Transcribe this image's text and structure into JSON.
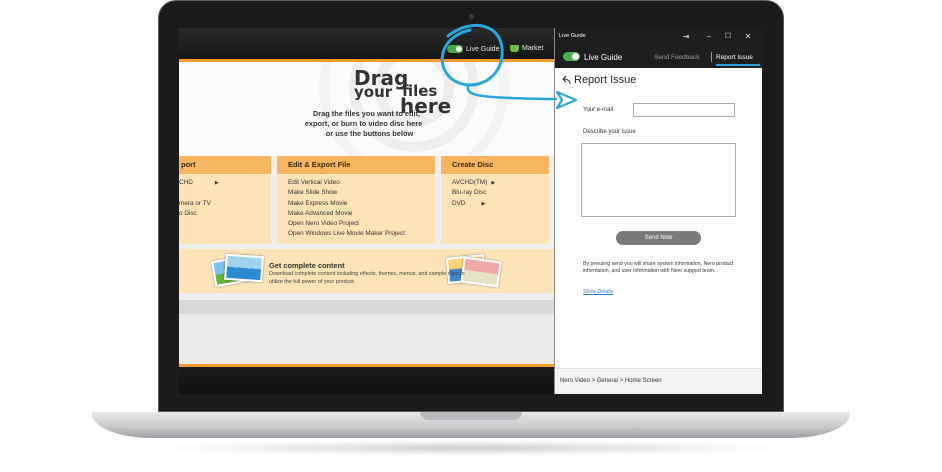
{
  "app": {
    "toolbar": {
      "live_guide": "Live Guide",
      "market": "Market"
    },
    "drop_area": {
      "drag_words": [
        "Drag",
        "your",
        "files",
        "here"
      ],
      "instructions": [
        "Drag the files you want to edit,",
        "export, or burn to video disc here",
        "or use the buttons below"
      ]
    },
    "columns": [
      {
        "heading": "port",
        "items": [
          "CHD",
          "mera or TV",
          "o Disc"
        ],
        "arrow_item": "CHD"
      },
      {
        "heading": "Edit & Export File",
        "items": [
          "Edit Vertical Video",
          "Make Slide Show",
          "Make Express Movie",
          "Make Advanced Movie",
          "Open Nero Video Project",
          "Open Windows Live Movie Maker Project"
        ]
      },
      {
        "heading": "Create Disc",
        "items": [
          "AVCHD(TM)",
          "Blu-ray Disc",
          "DVD"
        ],
        "arrow_items": [
          "AVCHD(TM)",
          "DVD"
        ]
      }
    ],
    "content_band": {
      "title": "Get complete content",
      "description": "Download complete content including effects, themes, menus, and sample clips to utilize the full power of your product."
    }
  },
  "panel": {
    "window_title": "Live Guide",
    "window_buttons": [
      "pin",
      "minimize",
      "maximize",
      "close"
    ],
    "header": {
      "live_guide": "Live Guide",
      "toggle_on": true,
      "send_feedback": "Send Feedback",
      "report_issue": "Report Issue"
    },
    "form": {
      "title": "Report Issue",
      "email_label": "Your e-mail",
      "email_value": "",
      "describe_label": "Describe your issue",
      "describe_value": "",
      "send_button": "Send Now",
      "info": "By pressing send you will share system information, Nero product information, and user information with Nero support team.",
      "show_details": "Show Details"
    },
    "breadcrumb": "Nero Video > General > Home Screen"
  },
  "colors": {
    "accent_orange": "#f39b2d",
    "column_header": "#f8b560",
    "column_body": "#fde3b6",
    "toggle_green": "#4caf50",
    "annotation_blue": "#2aa7d8",
    "tab_underline": "#2d9ee0"
  },
  "icons": [
    "toggle-icon",
    "cart-icon",
    "back-arrow-icon",
    "pin-icon",
    "minimize-icon",
    "maximize-icon",
    "close-icon",
    "play-arrow-icon"
  ]
}
